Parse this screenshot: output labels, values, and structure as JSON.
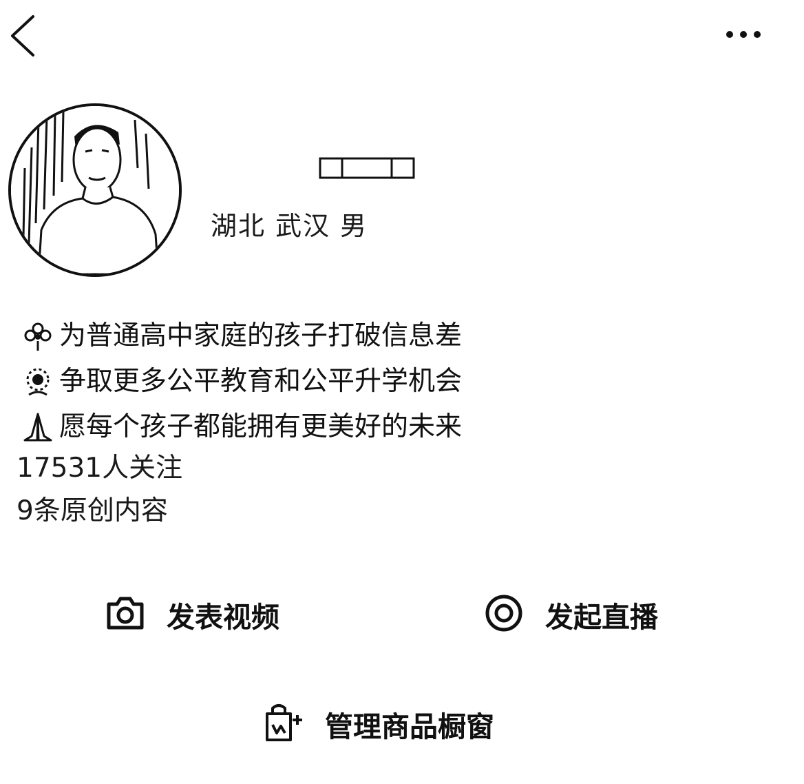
{
  "header": {
    "back_icon": "chevron-left-icon",
    "more_icon": "more-dots-icon"
  },
  "profile": {
    "avatar": "avatar-photo",
    "location": "湖北 武汉 男"
  },
  "bio": {
    "lines": [
      {
        "emoji": "flower-icon",
        "text": "为普通高中家庭的孩子打破信息差"
      },
      {
        "emoji": "sunflower-icon",
        "text": "争取更多公平教育和公平升学机会"
      },
      {
        "emoji": "praying-hands-icon",
        "text": "愿每个孩子都能拥有更美好的未来"
      }
    ],
    "followers": "17531人关注",
    "original_count": "9条原创内容"
  },
  "actions": {
    "publish_video": {
      "label": "发表视频",
      "icon": "camera-icon"
    },
    "start_live": {
      "label": "发起直播",
      "icon": "live-circle-icon"
    },
    "manage_shop": {
      "label": "管理商品橱窗",
      "icon": "shopping-bag-icon"
    }
  },
  "colors": {
    "background": "#ffffff",
    "foreground": "#111111"
  }
}
